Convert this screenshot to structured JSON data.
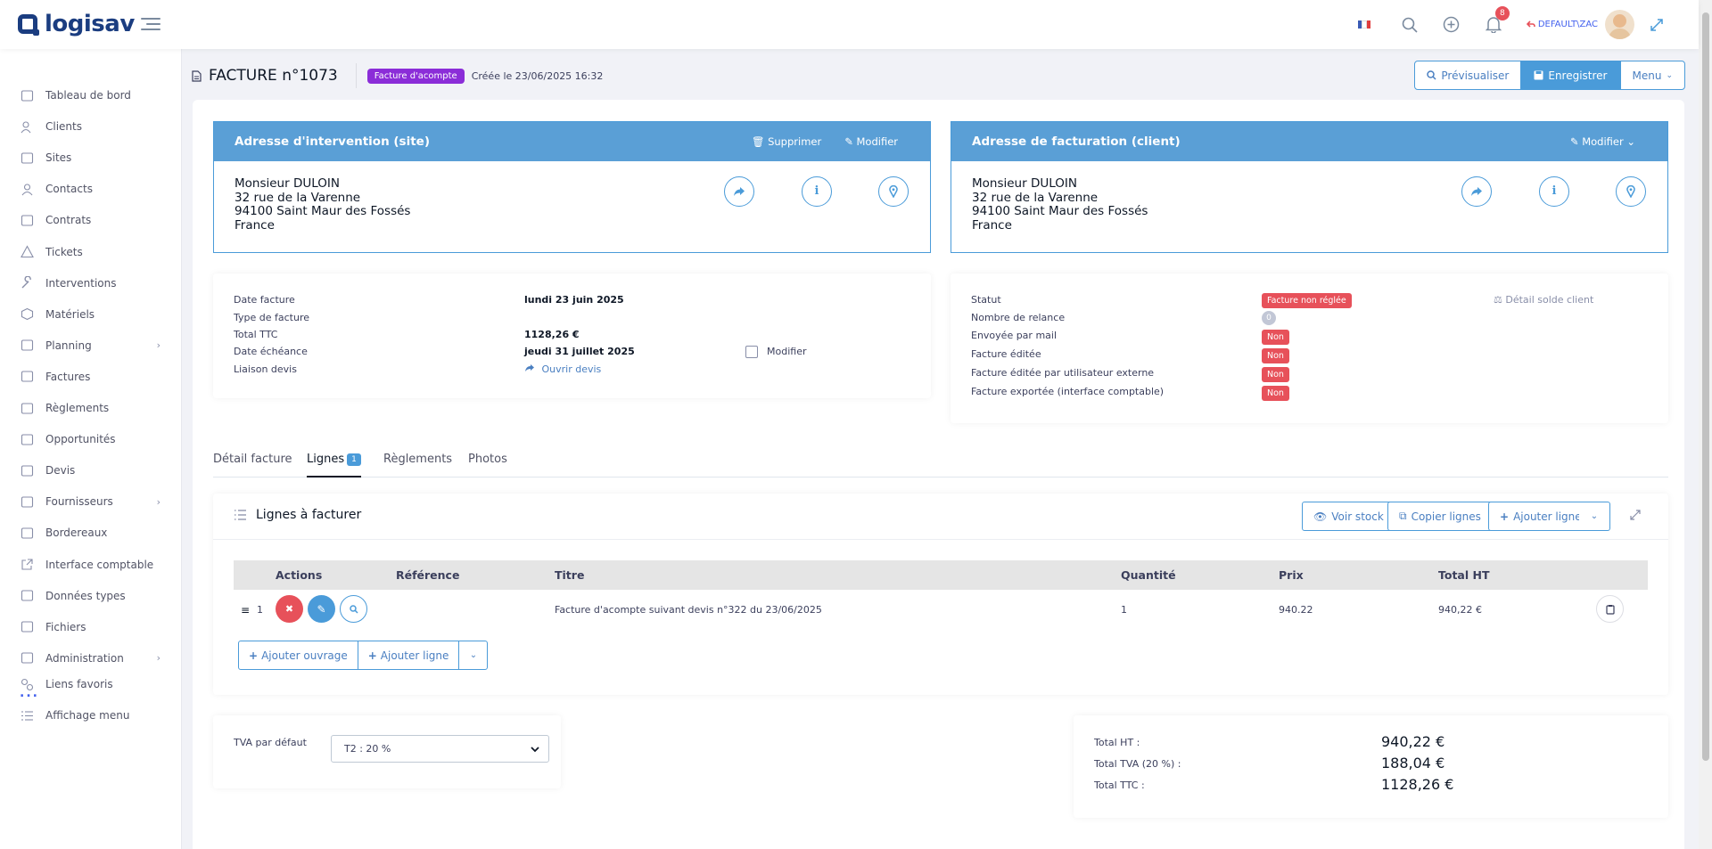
{
  "app": {
    "logo_text": "logisav",
    "brand_color": "#1b3d80",
    "accent_color": "#4a9bd9",
    "danger_color": "#e7515a"
  },
  "topbar": {
    "notification_count": "8",
    "user_label": "DEFAULT\\ZAC"
  },
  "sidebar": {
    "items": [
      {
        "label": "Tableau de bord",
        "icon": "dashboard-icon"
      },
      {
        "label": "Clients",
        "icon": "clients-icon"
      },
      {
        "label": "Sites",
        "icon": "sites-icon"
      },
      {
        "label": "Contacts",
        "icon": "contacts-icon"
      },
      {
        "label": "Contrats",
        "icon": "contracts-icon"
      },
      {
        "label": "Tickets",
        "icon": "tickets-icon"
      },
      {
        "label": "Interventions",
        "icon": "wrench-icon"
      },
      {
        "label": "Matériels",
        "icon": "box-icon"
      },
      {
        "label": "Planning",
        "icon": "calendar-icon",
        "has_submenu": true
      },
      {
        "label": "Factures",
        "icon": "invoice-icon"
      },
      {
        "label": "Règlements",
        "icon": "payment-icon"
      },
      {
        "label": "Opportunités",
        "icon": "opportunity-icon"
      },
      {
        "label": "Devis",
        "icon": "quote-icon"
      },
      {
        "label": "Fournisseurs",
        "icon": "truck-icon",
        "has_submenu": true
      },
      {
        "label": "Bordereaux",
        "icon": "slip-icon"
      },
      {
        "label": "Interface comptable",
        "icon": "external-link-icon"
      },
      {
        "label": "Données types",
        "icon": "data-types-icon"
      },
      {
        "label": "Fichiers",
        "icon": "files-icon"
      },
      {
        "label": "Administration",
        "icon": "admin-icon",
        "has_submenu": true
      }
    ],
    "more": "...",
    "footer_items": [
      {
        "label": "Liens favoris",
        "icon": "link-icon"
      },
      {
        "label": "Affichage menu",
        "icon": "menu-list-icon"
      }
    ]
  },
  "page": {
    "title": "FACTURE n°1073",
    "type_badge": "Facture d'acompte",
    "created": "Créée le 23/06/2025 16:32",
    "buttons": {
      "preview": "Prévisualiser",
      "save": "Enregistrer",
      "menu": "Menu"
    }
  },
  "site_address": {
    "title": "Adresse d'intervention (site)",
    "delete": "Supprimer",
    "edit": "Modifier",
    "lines": [
      "Monsieur DULOIN",
      "32 rue de la Varenne",
      "94100 Saint Maur des Fossés",
      "France"
    ]
  },
  "billing_address": {
    "title": "Adresse de facturation (client)",
    "edit": "Modifier",
    "lines": [
      "Monsieur DULOIN",
      "32 rue de la Varenne",
      "94100 Saint Maur des Fossés",
      "France"
    ]
  },
  "invoice_info": {
    "date_label": "Date facture",
    "date_value": "lundi 23 juin 2025",
    "type_label": "Type de facture",
    "ttc_label": "Total TTC",
    "ttc_value": "1128,26 €",
    "due_label": "Date échéance",
    "due_value": "jeudi 31 juillet 2025",
    "modify_label": "Modifier",
    "quote_label": "Liaison devis",
    "quote_link": "Ouvrir devis"
  },
  "status_info": {
    "status_label": "Statut",
    "status_value": "Facture non réglée",
    "balance_link": "Détail solde client",
    "reminders_label": "Nombre de relance",
    "reminders_value": "0",
    "rows": [
      {
        "label": "Envoyée par mail",
        "value": "Non"
      },
      {
        "label": "Facture éditée",
        "value": "Non"
      },
      {
        "label": "Facture éditée par utilisateur externe",
        "value": "Non"
      },
      {
        "label": "Facture exportée (interface comptable)",
        "value": "Non"
      }
    ]
  },
  "tabs": [
    {
      "label": "Détail facture"
    },
    {
      "label": "Lignes",
      "badge": "1",
      "active": true
    },
    {
      "label": "Règlements"
    },
    {
      "label": "Photos"
    }
  ],
  "lines": {
    "title": "Lignes à facturer",
    "buttons": {
      "stock": "Voir stock",
      "copy": "Copier lignes",
      "add": "Ajouter ligne"
    },
    "columns": [
      "Actions",
      "Référence",
      "Titre",
      "Quantité",
      "Prix",
      "Total HT"
    ],
    "rows": [
      {
        "index": "1",
        "reference": "",
        "title": "Facture d'acompte suivant devis n°322 du 23/06/2025",
        "quantity": "1",
        "price": "940.22",
        "total": "940,22 €"
      }
    ],
    "bottom_buttons": {
      "add_work": "Ajouter ouvrage",
      "add_line": "Ajouter ligne"
    }
  },
  "vat": {
    "label": "TVA par défaut",
    "selected": "T2 : 20 %"
  },
  "totals": {
    "ht_label": "Total HT :",
    "ht_value": "940,22 €",
    "tva_label": "Total TVA (20 %) :",
    "tva_value": "188,04 €",
    "ttc_label": "Total TTC :",
    "ttc_value": "1128,26 €"
  }
}
